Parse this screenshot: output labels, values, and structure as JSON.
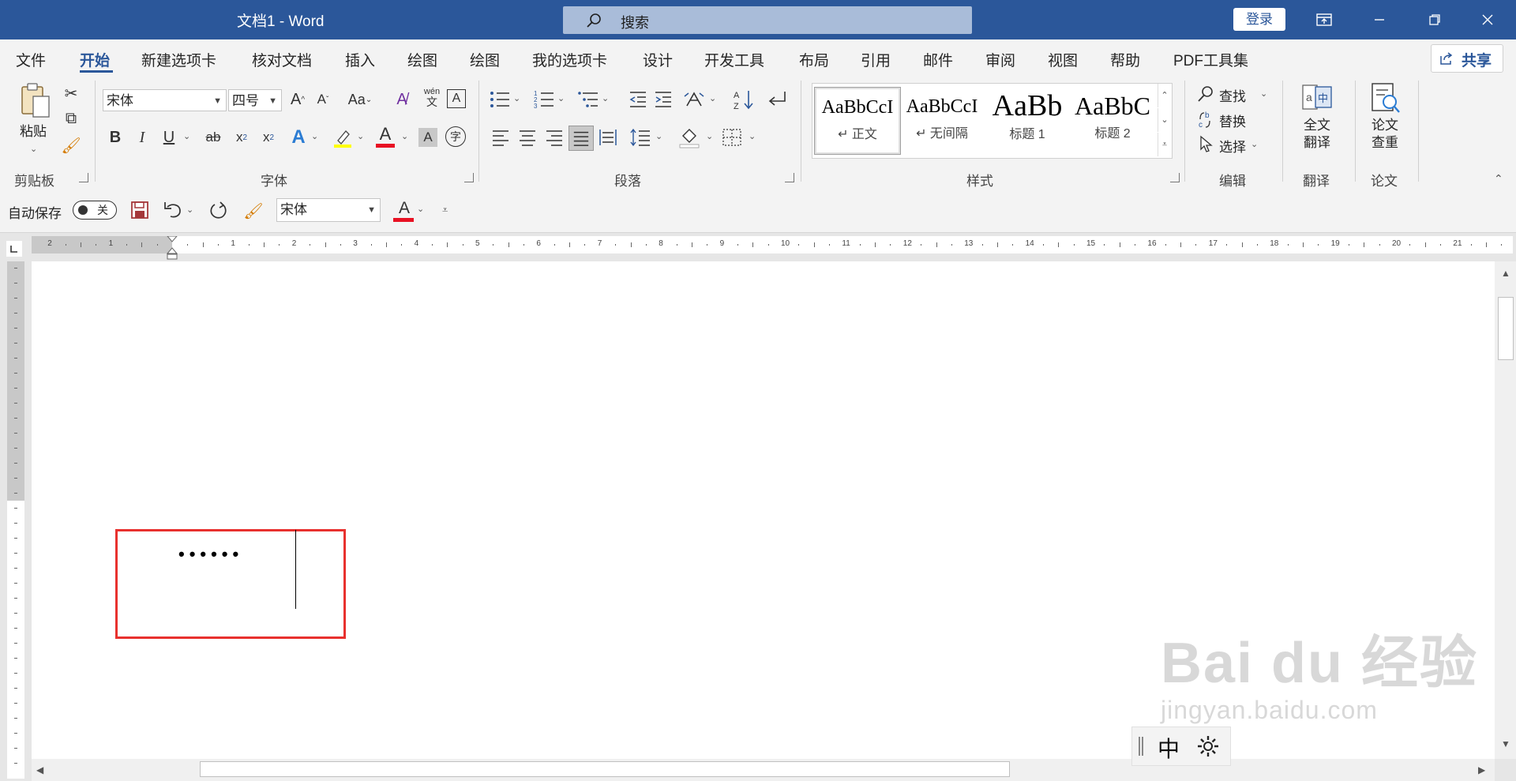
{
  "window": {
    "title": "文档1  -  Word",
    "login": "登录"
  },
  "search": {
    "placeholder": "搜索"
  },
  "tabs": [
    "文件",
    "开始",
    "新建选项卡",
    "核对文档",
    "插入",
    "绘图",
    "绘图",
    "我的选项卡",
    "设计",
    "开发工具",
    "布局",
    "引用",
    "邮件",
    "审阅",
    "视图",
    "帮助",
    "PDF工具集"
  ],
  "active_tab": "开始",
  "share": {
    "label": "共享"
  },
  "ribbon": {
    "clipboard": {
      "paste": "粘贴",
      "group": "剪贴板"
    },
    "font": {
      "name": "宋体",
      "size": "四号",
      "group": "字体",
      "phonetic_top": "wén",
      "phonetic_bottom": "文"
    },
    "paragraph": {
      "group": "段落"
    },
    "styles": {
      "group": "样式",
      "items": [
        {
          "preview": "AaBbCcI",
          "name": "↵ 正文"
        },
        {
          "preview": "AaBbCcI",
          "name": "↵ 无间隔"
        },
        {
          "preview": "AaBb",
          "name": "标题 1"
        },
        {
          "preview": "AaBbC",
          "name": "标题 2"
        }
      ]
    },
    "editing": {
      "find": "查找",
      "replace": "替换",
      "select": "选择",
      "group": "编辑"
    },
    "translate": {
      "label_line1": "全文",
      "label_line2": "翻译",
      "group": "翻译"
    },
    "paper": {
      "label_line1": "论文",
      "label_line2": "查重",
      "group": "论文"
    }
  },
  "qat": {
    "autosave": "自动保存",
    "autosave_state": "关",
    "font": "宋体"
  },
  "ruler": {
    "left_numbers": [
      "2",
      "1"
    ],
    "numbers": [
      "1",
      "2",
      "3",
      "4",
      "5",
      "6",
      "7",
      "8",
      "9",
      "10",
      "11",
      "12",
      "13",
      "14",
      "15",
      "16",
      "17",
      "18",
      "19",
      "20",
      "21"
    ]
  },
  "document": {
    "bullets": "••••••"
  },
  "ime": {
    "mode": "中"
  },
  "watermark": {
    "brand": "Bai du 经验",
    "url": "jingyan.baidu.com"
  },
  "colors": {
    "accent": "#2b579a",
    "highlight_box": "#e8312e",
    "font_color": "#e81123",
    "highlight": "#ffff00"
  }
}
